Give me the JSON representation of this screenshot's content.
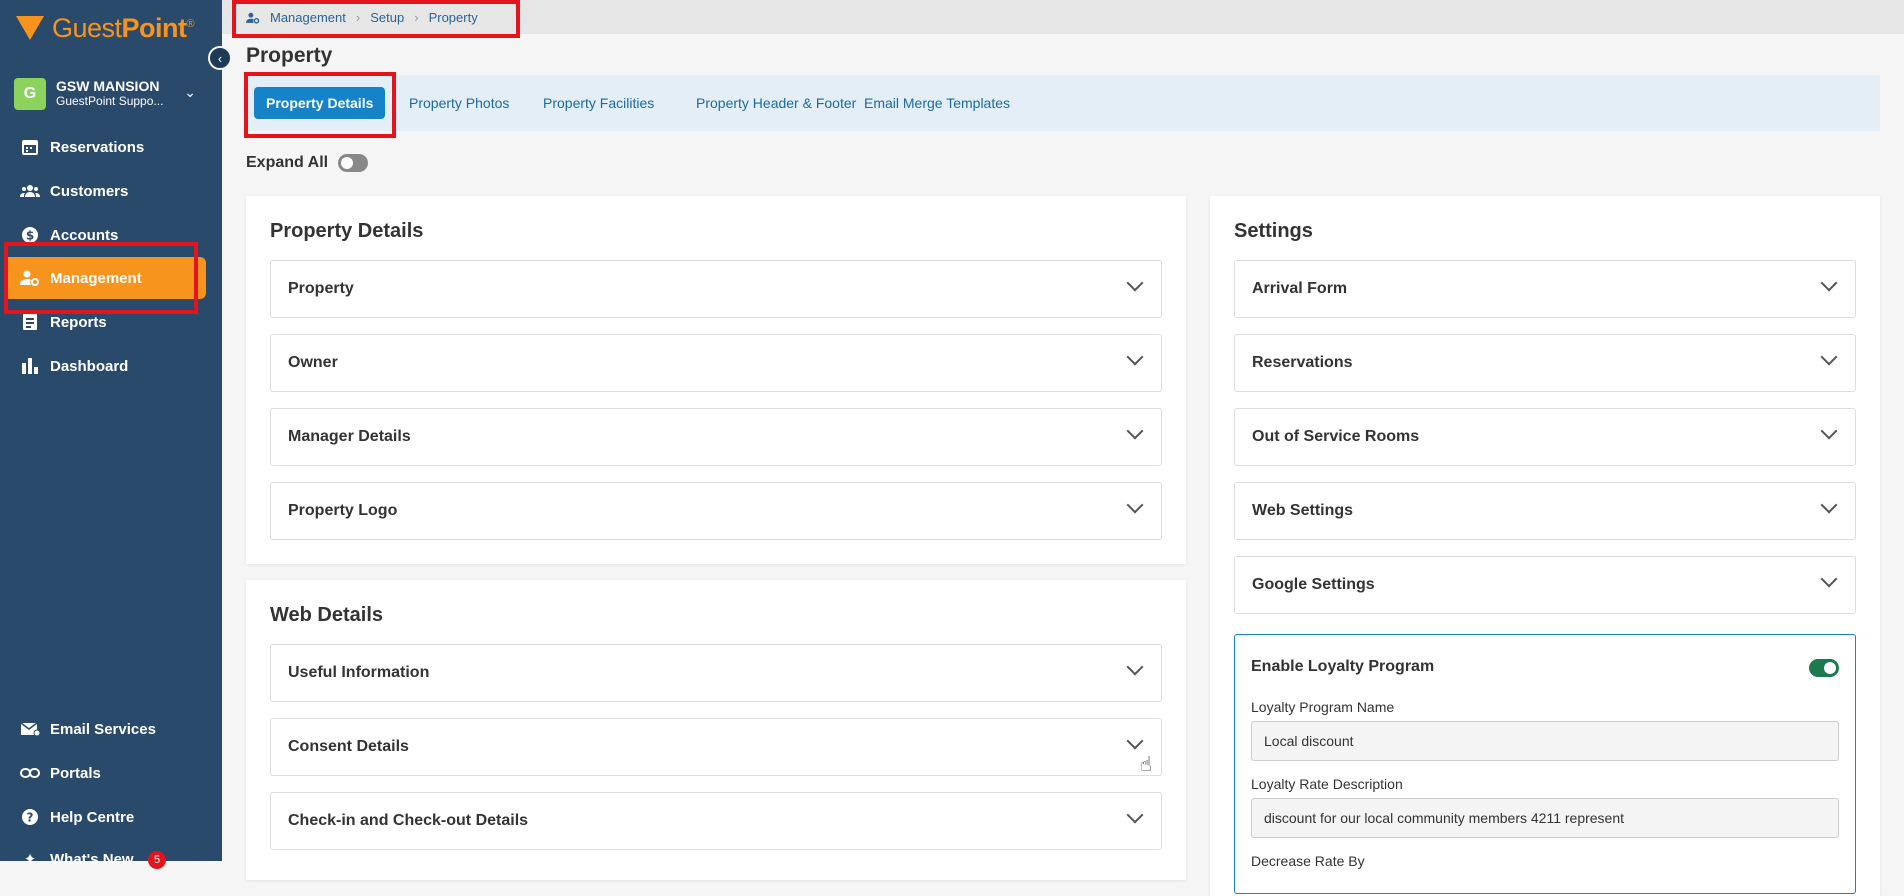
{
  "brand": {
    "name_a": "Guest",
    "name_b": "Point",
    "mark": "®",
    "accent": "#f7941d",
    "sidebar_bg": "#2a4a6b"
  },
  "property": {
    "avatar": "G",
    "name": "GSW MANSION",
    "subtitle": "GuestPoint Suppo..."
  },
  "nav": {
    "items": [
      {
        "label": "Reservations",
        "icon": "calendar-icon"
      },
      {
        "label": "Customers",
        "icon": "users-icon"
      },
      {
        "label": "Accounts",
        "icon": "dollar-icon"
      },
      {
        "label": "Management",
        "icon": "user-gear-icon",
        "active": true
      },
      {
        "label": "Reports",
        "icon": "report-icon"
      },
      {
        "label": "Dashboard",
        "icon": "bar-chart-icon"
      }
    ],
    "bottom": [
      {
        "label": "Email Services",
        "icon": "email-icon"
      },
      {
        "label": "Portals",
        "icon": "link-icon"
      },
      {
        "label": "Help Centre",
        "icon": "help-icon"
      },
      {
        "label": "What's New",
        "icon": "sparkle-icon",
        "badge": "5"
      }
    ]
  },
  "breadcrumb": [
    "Management",
    "Setup",
    "Property"
  ],
  "page": {
    "title": "Property"
  },
  "tabs": [
    "Property Details",
    "Property Photos",
    "Property Facilities",
    "Property Header & Footer",
    "Email Merge Templates"
  ],
  "expand_all": {
    "label": "Expand All",
    "on": false
  },
  "property_details": {
    "title": "Property Details",
    "sections": [
      "Property",
      "Owner",
      "Manager Details",
      "Property Logo"
    ]
  },
  "web_details": {
    "title": "Web Details",
    "sections": [
      "Useful Information",
      "Consent Details",
      "Check-in and Check-out Details"
    ]
  },
  "settings": {
    "title": "Settings",
    "sections": [
      "Arrival Form",
      "Reservations",
      "Out of Service Rooms",
      "Web Settings",
      "Google Settings"
    ],
    "loyalty": {
      "title": "Enable Loyalty Program",
      "enabled": true,
      "name_label": "Loyalty Program Name",
      "name_value": "Local discount",
      "desc_label": "Loyalty Rate Description",
      "desc_value": "discount for our local community members 4211 represent",
      "decrease_label": "Decrease Rate By"
    }
  }
}
